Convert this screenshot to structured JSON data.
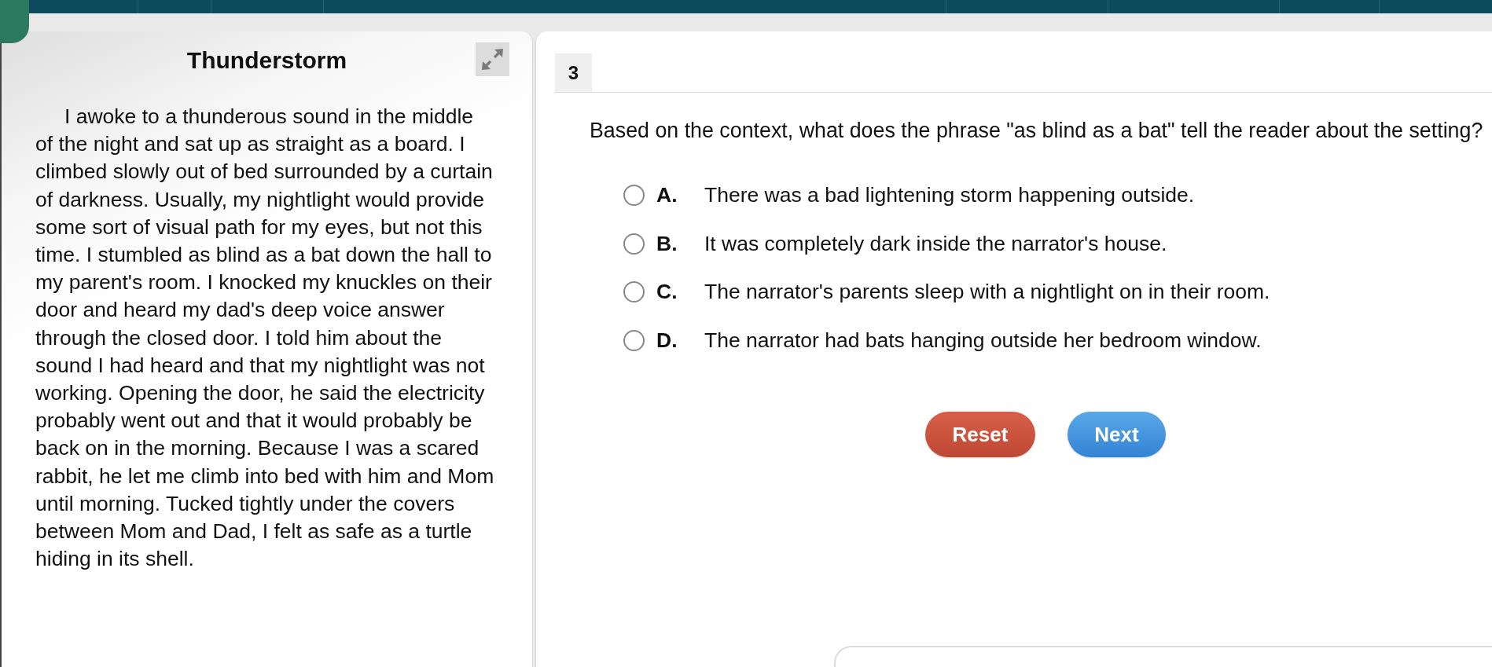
{
  "passage": {
    "title": "Thunderstorm",
    "text": "I awoke to a thunderous sound in the middle of the night and sat up as straight as a board. I climbed slowly out of bed surrounded by a curtain of darkness. Usually, my nightlight would provide some sort of visual path for my eyes, but not this time. I stumbled as blind as a bat down the hall to my parent's room. I knocked my knuckles on their door and heard my dad's deep voice answer through the closed door. I told him about the sound I had heard and that my nightlight was not working. Opening the door, he said the electricity probably went out and that it would probably be back on in the morning. Because I was a scared rabbit, he let me climb into bed with him and Mom until morning. Tucked tightly under the covers between Mom and Dad, I felt as safe as a turtle hiding in its shell."
  },
  "question": {
    "number": "3",
    "prompt": "Based on the context, what does the phrase \"as blind as a bat\" tell the reader about the setting?",
    "options": [
      {
        "letter": "A.",
        "text": "There was a bad lightening storm happening outside.",
        "selected": false
      },
      {
        "letter": "B.",
        "text": "It was completely dark inside the narrator's house.",
        "selected": false
      },
      {
        "letter": "C.",
        "text": "The narrator's parents sleep with a nightlight on in their room.",
        "selected": false
      },
      {
        "letter": "D.",
        "text": "The narrator had bats hanging outside her bedroom window.",
        "selected": false
      }
    ]
  },
  "buttons": [
    {
      "label": "Reset",
      "kind": "reset"
    },
    {
      "label": "Next",
      "kind": "next"
    }
  ]
}
